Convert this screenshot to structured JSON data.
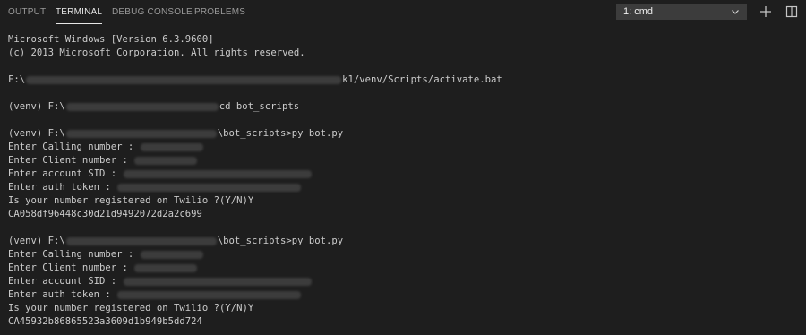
{
  "tabs": [
    {
      "label": "OUTPUT"
    },
    {
      "label": "TERMINAL",
      "active": true
    },
    {
      "label": "DEBUG CONSOLE"
    },
    {
      "label": "PROBLEMS"
    }
  ],
  "terminal_select": {
    "value": "1: cmd"
  },
  "actions": {
    "new_terminal": "plus-icon",
    "split_terminal": "split-icon"
  },
  "colors": {
    "background": "#1e1e1e",
    "text": "#cccccc",
    "tab_active": "#e7e7e7",
    "tab_inactive": "#9a9a9a",
    "select_bg": "#3c3c3c"
  },
  "terminal": {
    "line1": "Microsoft Windows [Version 6.3.9600]",
    "line2": "(c) 2013 Microsoft Corporation. All rights reserved.",
    "activate_prefix": "F:\\",
    "activate_suffix": "k1/venv/Scripts/activate.bat",
    "cd_prefix": "(venv) F:\\",
    "cd_suffix": "cd bot_scripts",
    "run1_prefix": "(venv) F:\\",
    "run1_suffix": "\\bot_scripts>py bot.py",
    "calling_label": "Enter Calling number :",
    "client_label": "Enter Client number :",
    "sid_label": "Enter account SID :",
    "token_label": "Enter auth token :",
    "registered": "Is your number registered on Twilio ?(Y/N)Y",
    "call_sid1": "CA058df96448c30d21d9492072d2a2c699",
    "run2_prefix": "(venv) F:\\",
    "run2_suffix": "\\bot_scripts>py bot.py",
    "call_sid2": "CA45932b86865523a3609d1b949b5dd724"
  }
}
